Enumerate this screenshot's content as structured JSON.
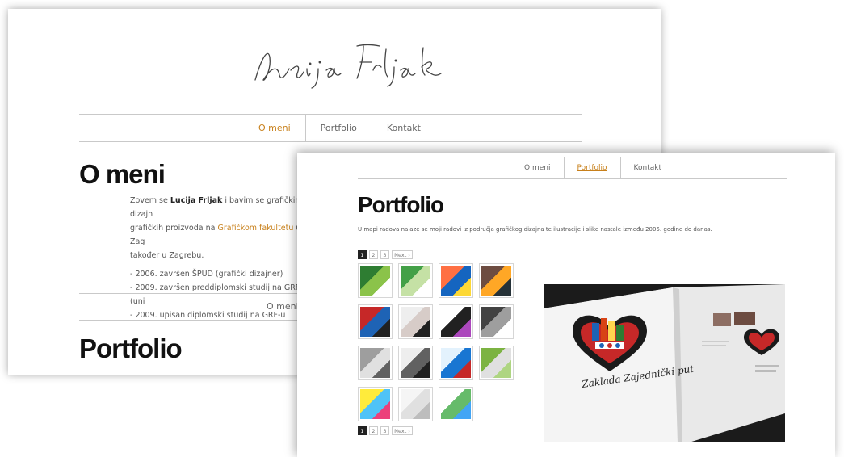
{
  "win1": {
    "signature": "Lucija Frljak",
    "nav": [
      {
        "label": "O meni",
        "active": true
      },
      {
        "label": "Portfolio",
        "active": false
      },
      {
        "label": "Kontakt",
        "active": false
      }
    ],
    "title": "O meni",
    "bio": {
      "line1_pre": "Zovem se ",
      "name": "Lucija Frljak",
      "line1_post": " i bavim se grafičkim dizajn",
      "line2_pre": "grafičkih proizvoda na ",
      "link": "Grafičkom fakultetu",
      "line2_post": " u Zag",
      "line3": "također u Zagrebu.",
      "items": [
        "- 2006. završen ŠPUD (grafički dizajner)",
        "- 2009. završen preddiplomski studij na GRF-u (uni",
        "- 2009. upisan diplomski studij na GRF-u"
      ]
    },
    "subnav_label": "O meni",
    "section2_title": "Portfolio"
  },
  "win2": {
    "nav": [
      {
        "label": "O meni",
        "active": false
      },
      {
        "label": "Portfolio",
        "active": true
      },
      {
        "label": "Kontakt",
        "active": false
      }
    ],
    "title": "Portfolio",
    "description": "U mapi radova nalaze se moji radovi iz područja grafičkog dizajna te ilustracije i slike nastale između 2005. godine do danas.",
    "pager": [
      "1",
      "2",
      "3",
      "Next ›"
    ],
    "thumbs": [
      {
        "name": "green-brochure"
      },
      {
        "name": "green-poster"
      },
      {
        "name": "ponos-poster"
      },
      {
        "name": "abstract-illustration"
      },
      {
        "name": "heart-illustration"
      },
      {
        "name": "book-spread"
      },
      {
        "name": "lm-design-logo"
      },
      {
        "name": "bw-illustration"
      },
      {
        "name": "grey-photo"
      },
      {
        "name": "figure-sculpture"
      },
      {
        "name": "mlijeko-packaging"
      },
      {
        "name": "green-sketch"
      },
      {
        "name": "color-mosaic"
      },
      {
        "name": "white-tshirt"
      },
      {
        "name": "leaflet-set"
      }
    ],
    "photo": {
      "caption": "Zaklada Zajednički put"
    }
  },
  "colors": {
    "accent": "#c8801b",
    "text": "#333333",
    "rule": "#c9c9c9"
  }
}
